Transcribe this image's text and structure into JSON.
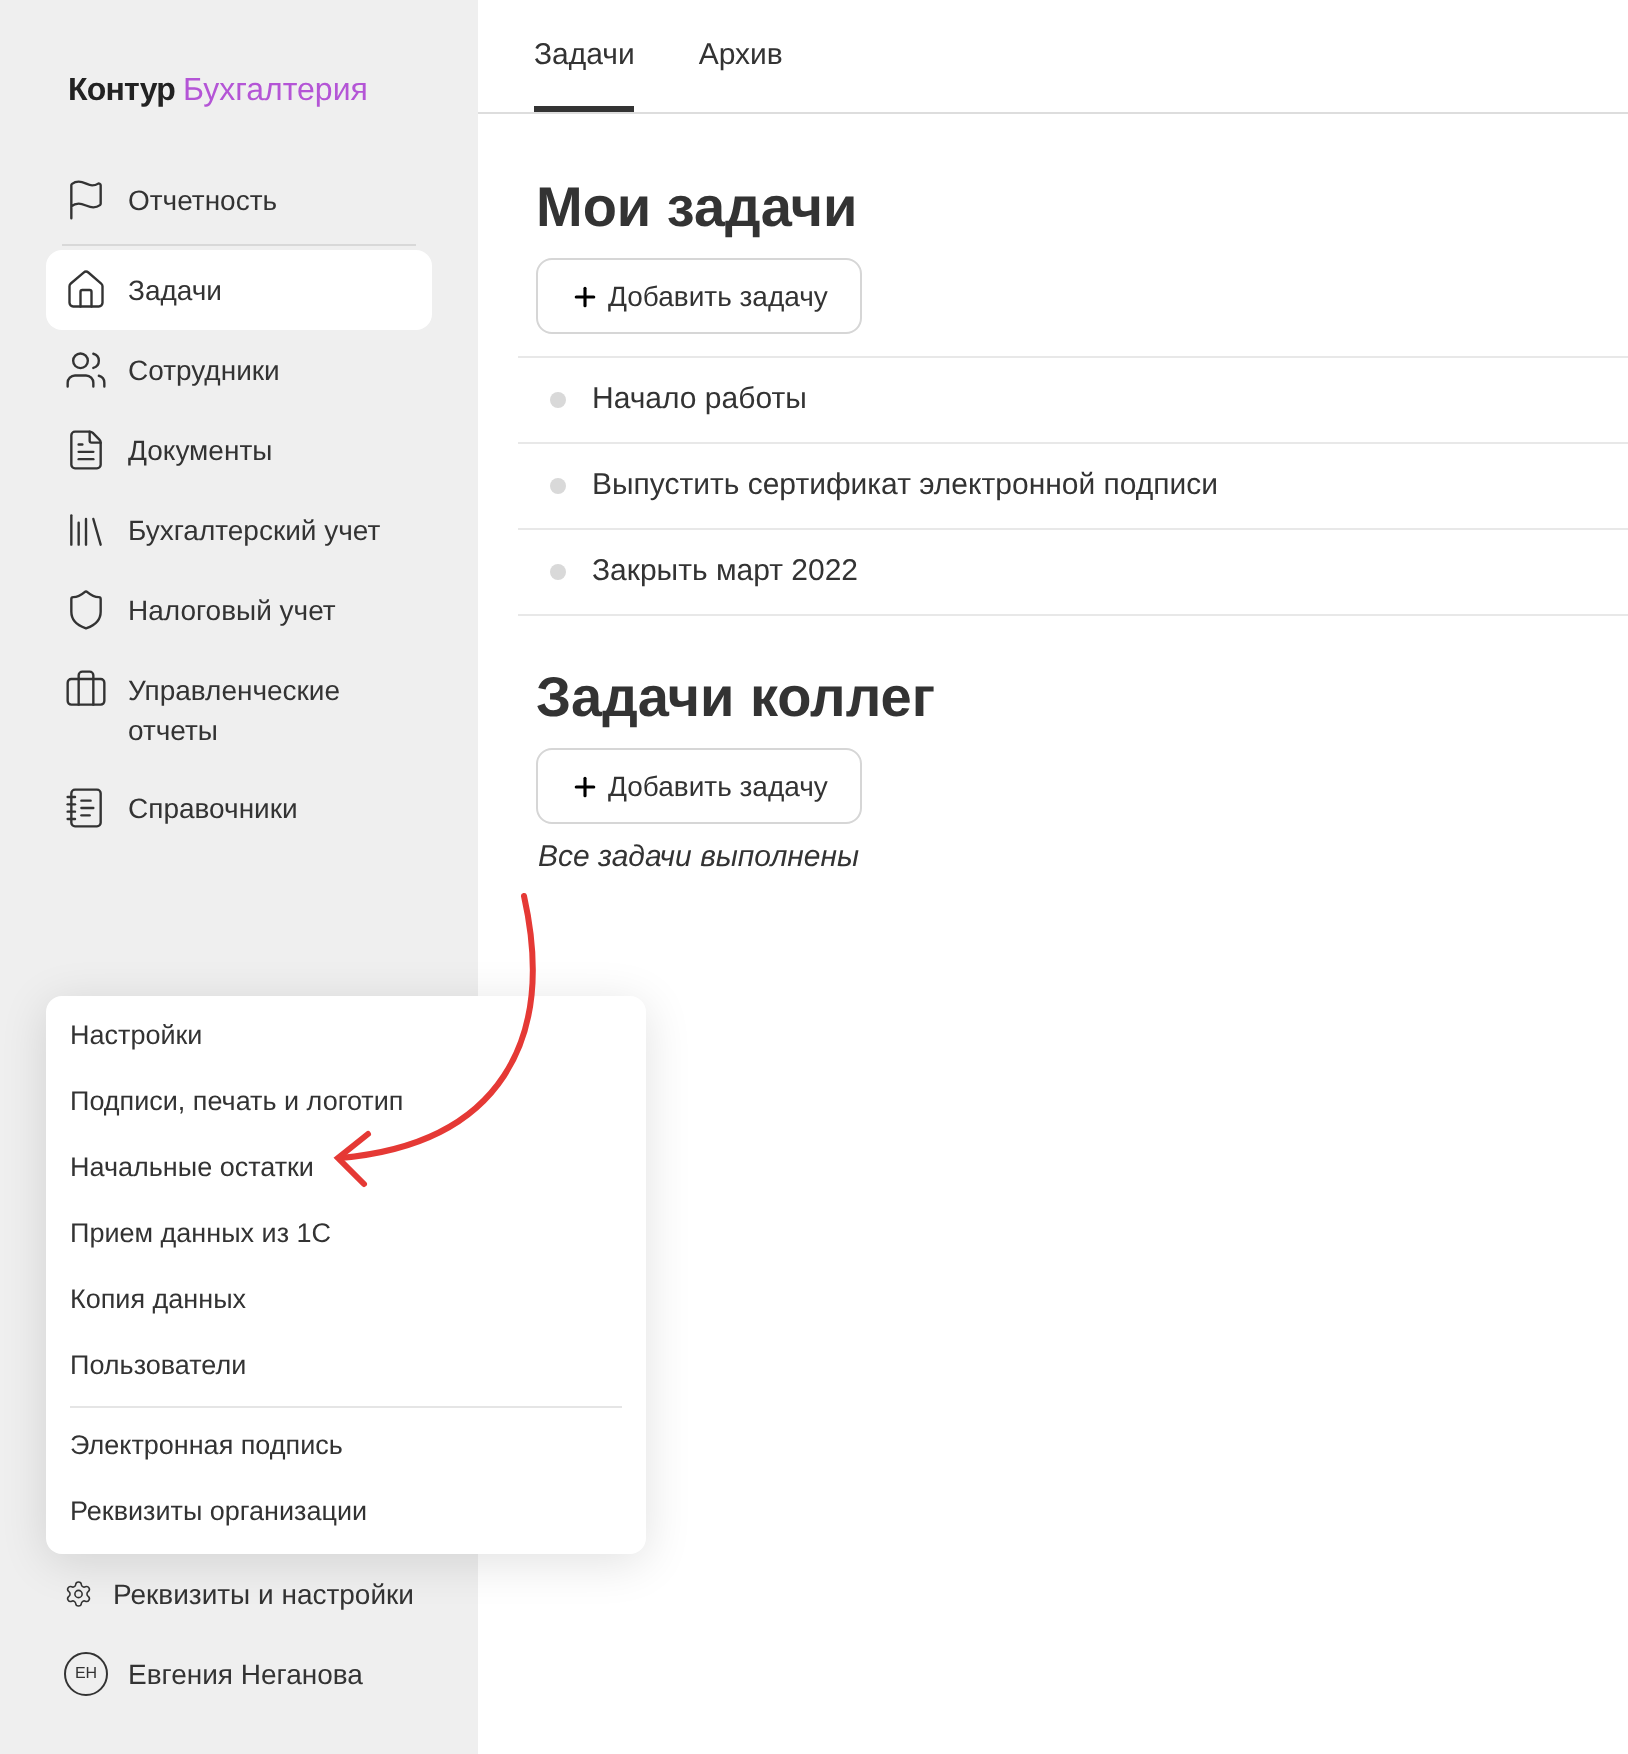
{
  "logo": {
    "brand": "Контур",
    "product": "Бухгалтерия"
  },
  "sidebar": {
    "items": [
      {
        "label": "Отчетность",
        "selected": false
      },
      {
        "label": "Задачи",
        "selected": true
      },
      {
        "label": "Сотрудники",
        "selected": false
      },
      {
        "label": "Документы",
        "selected": false
      },
      {
        "label": "Бухгалтерский учет",
        "selected": false
      },
      {
        "label": "Налоговый учет",
        "selected": false
      },
      {
        "label": "Управленческие отчеты",
        "selected": false
      },
      {
        "label": "Справочники",
        "selected": false
      }
    ],
    "settings": {
      "label": "Реквизиты и настройки"
    },
    "user": {
      "initials": "ЕН",
      "name": "Евгения Неганова"
    }
  },
  "settings_menu": {
    "groups": [
      [
        "Настройки",
        "Подписи, печать и логотип",
        "Начальные остатки",
        "Прием данных из 1С",
        "Копия данных",
        "Пользователи"
      ],
      [
        "Электронная подпись",
        "Реквизиты организации"
      ]
    ]
  },
  "tabs": [
    {
      "label": "Задачи",
      "selected": true
    },
    {
      "label": "Архив",
      "selected": false
    }
  ],
  "my_tasks": {
    "title": "Мои задачи",
    "add_button": "Добавить задачу",
    "tasks": [
      "Начало работы",
      "Выпустить сертификат электронной подписи",
      "Закрыть март 2022"
    ]
  },
  "colleague_tasks": {
    "title": "Задачи коллег",
    "add_button": "Добавить задачу",
    "empty_text": "Все задачи выполнены"
  }
}
